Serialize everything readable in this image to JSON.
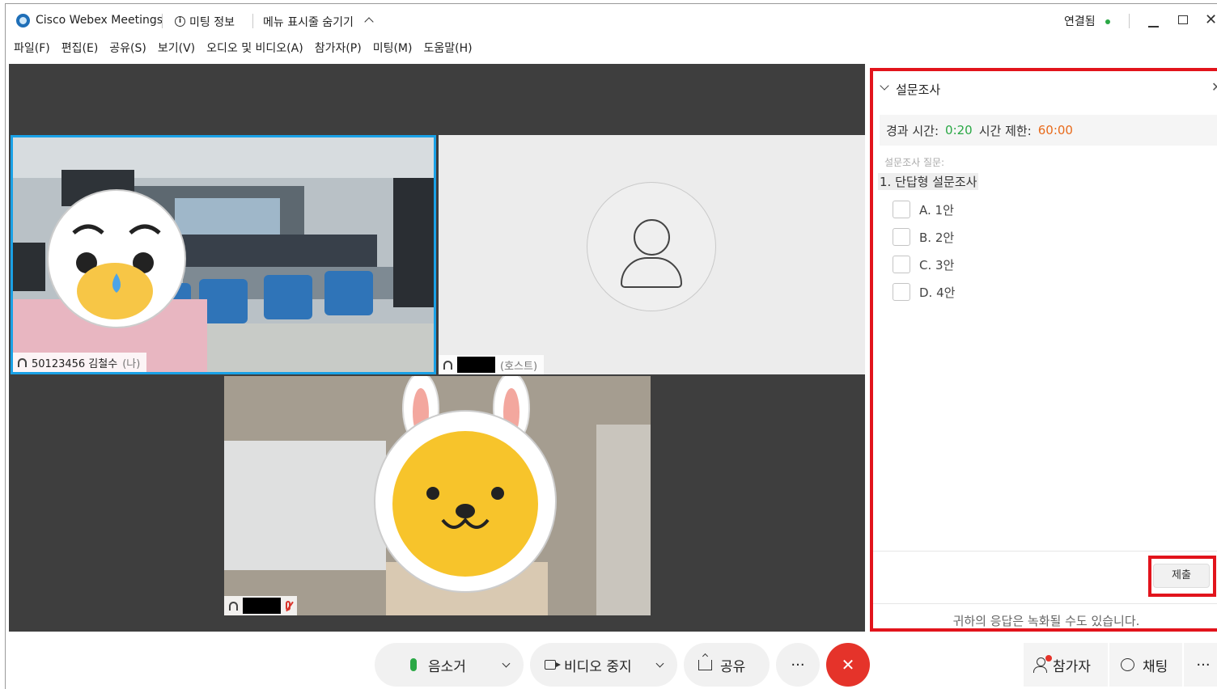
{
  "window": {
    "app_title": "Cisco Webex Meetings",
    "meeting_info": "미팅 정보",
    "hide_menu": "메뉴 표시줄 숨기기",
    "connection_status": "연결됨",
    "colors": {
      "status_dot": "#2aa845",
      "accent_blue": "#1aa1e6",
      "highlight_red": "#e2141c",
      "end_red": "#e5332a"
    }
  },
  "menu": [
    "파일(F)",
    "편집(E)",
    "공유(S)",
    "보기(V)",
    "오디오 및 비디오(A)",
    "참가자(P)",
    "미팅(M)",
    "도움말(H)"
  ],
  "videos": {
    "self": {
      "name": "50123456 김철수",
      "me_suffix": "(나)"
    },
    "host": {
      "role_suffix": "(호스트)"
    }
  },
  "poll": {
    "title": "설문조사",
    "elapsed_label": "경과 시간:",
    "elapsed_value": "0:20",
    "limit_label": "시간 제한:",
    "limit_value": "60:00",
    "question_label": "설문조사 질문:",
    "question": "1.  단답형 설문조사",
    "options": [
      "A.  1안",
      "B.  2안",
      "C.  3안",
      "D.  4안"
    ],
    "submit_label": "제출",
    "note": "귀하의 응답은 녹화될 수도 있습니다."
  },
  "controls": {
    "mute": "음소거",
    "stop_video": "비디오 중지",
    "share": "공유",
    "more": "···",
    "end": "✕",
    "participants": "참가자",
    "chat": "채팅",
    "panel_more": "···"
  }
}
